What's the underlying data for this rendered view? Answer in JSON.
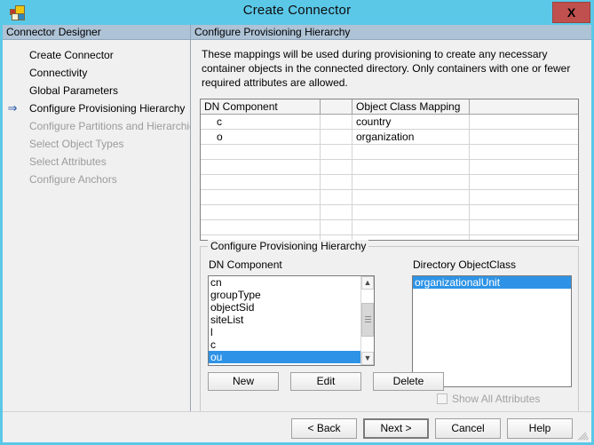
{
  "window": {
    "title": "Create Connector",
    "icon": "app-window-icon",
    "close_label": "X",
    "close_color": "#c0504d",
    "titlebar_color": "#5bc8e8",
    "header_band_color": "#aec3d6",
    "selection_color": "#2e93e6"
  },
  "sidebar": {
    "header": "Connector Designer",
    "items": [
      {
        "label": "Create Connector",
        "state": "done",
        "current": false
      },
      {
        "label": "Connectivity",
        "state": "done",
        "current": false
      },
      {
        "label": "Global Parameters",
        "state": "done",
        "current": false
      },
      {
        "label": "Configure Provisioning Hierarchy",
        "state": "current",
        "current": true
      },
      {
        "label": "Configure Partitions and Hierarchies",
        "state": "disabled",
        "current": false
      },
      {
        "label": "Select Object Types",
        "state": "disabled",
        "current": false
      },
      {
        "label": "Select Attributes",
        "state": "disabled",
        "current": false
      },
      {
        "label": "Configure Anchors",
        "state": "disabled",
        "current": false
      }
    ],
    "current_arrow_icon": "arrow-right-icon"
  },
  "main": {
    "header": "Configure Provisioning Hierarchy",
    "description": "These mappings will be used during provisioning to create any necessary container objects in the connected directory.  Only containers with one or fewer required attributes are allowed.",
    "grid": {
      "columns": [
        "DN Component",
        "",
        "Object Class Mapping",
        ""
      ],
      "rows": [
        [
          "c",
          "",
          "country",
          ""
        ],
        [
          "o",
          "",
          "organization",
          ""
        ]
      ],
      "empty_row_count": 6
    },
    "groupbox": {
      "title": "Configure Provisioning Hierarchy",
      "dn_label": "DN Component",
      "objectclass_label": "Directory ObjectClass",
      "dn_items": [
        {
          "label": "cn",
          "selected": false
        },
        {
          "label": "groupType",
          "selected": false
        },
        {
          "label": "objectSid",
          "selected": false
        },
        {
          "label": "siteList",
          "selected": false
        },
        {
          "label": "l",
          "selected": false
        },
        {
          "label": "c",
          "selected": false
        },
        {
          "label": "ou",
          "selected": true
        }
      ],
      "objectclass_items": [
        {
          "label": "organizationalUnit",
          "selected": true
        }
      ],
      "buttons": {
        "new": "New",
        "edit": "Edit",
        "delete": "Delete"
      },
      "checkbox": {
        "label": "Show All Attributes",
        "checked": false,
        "enabled": false
      },
      "scrollbar": {
        "up_icon": "chevron-up-icon",
        "down_icon": "chevron-down-icon"
      }
    }
  },
  "footer": {
    "back": "< Back",
    "next": "Next  >",
    "cancel": "Cancel",
    "help": "Help"
  }
}
